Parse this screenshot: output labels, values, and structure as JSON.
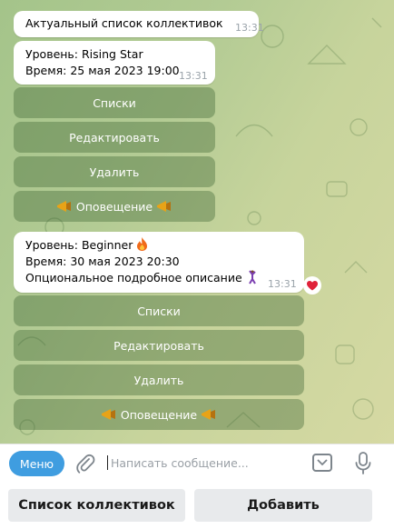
{
  "messages": [
    {
      "text": "Актуальный список коллективок",
      "time": "13:31"
    },
    {
      "lines": [
        "Уровень: Rising Star",
        "Время: 25 мая 2023  19:00"
      ],
      "time": "13:31",
      "buttons": [
        "Списки",
        "Редактировать",
        "Удалить",
        "Оповещение"
      ]
    },
    {
      "lines": [
        "Уровень: Beginner",
        "Время: 30 мая 2023  20:30",
        "Опциональное подробное описание"
      ],
      "time": "13:31",
      "reaction": "heart-icon",
      "buttons": [
        "Списки",
        "Редактировать",
        "Удалить",
        "Оповещение"
      ]
    }
  ],
  "input": {
    "menu_label": "Меню",
    "placeholder": "Написать сообщение..."
  },
  "keyboard": {
    "left": "Список коллективок",
    "right": "Добавить"
  },
  "colors": {
    "accent": "#3f9de0",
    "reaction": "#e0223a"
  }
}
